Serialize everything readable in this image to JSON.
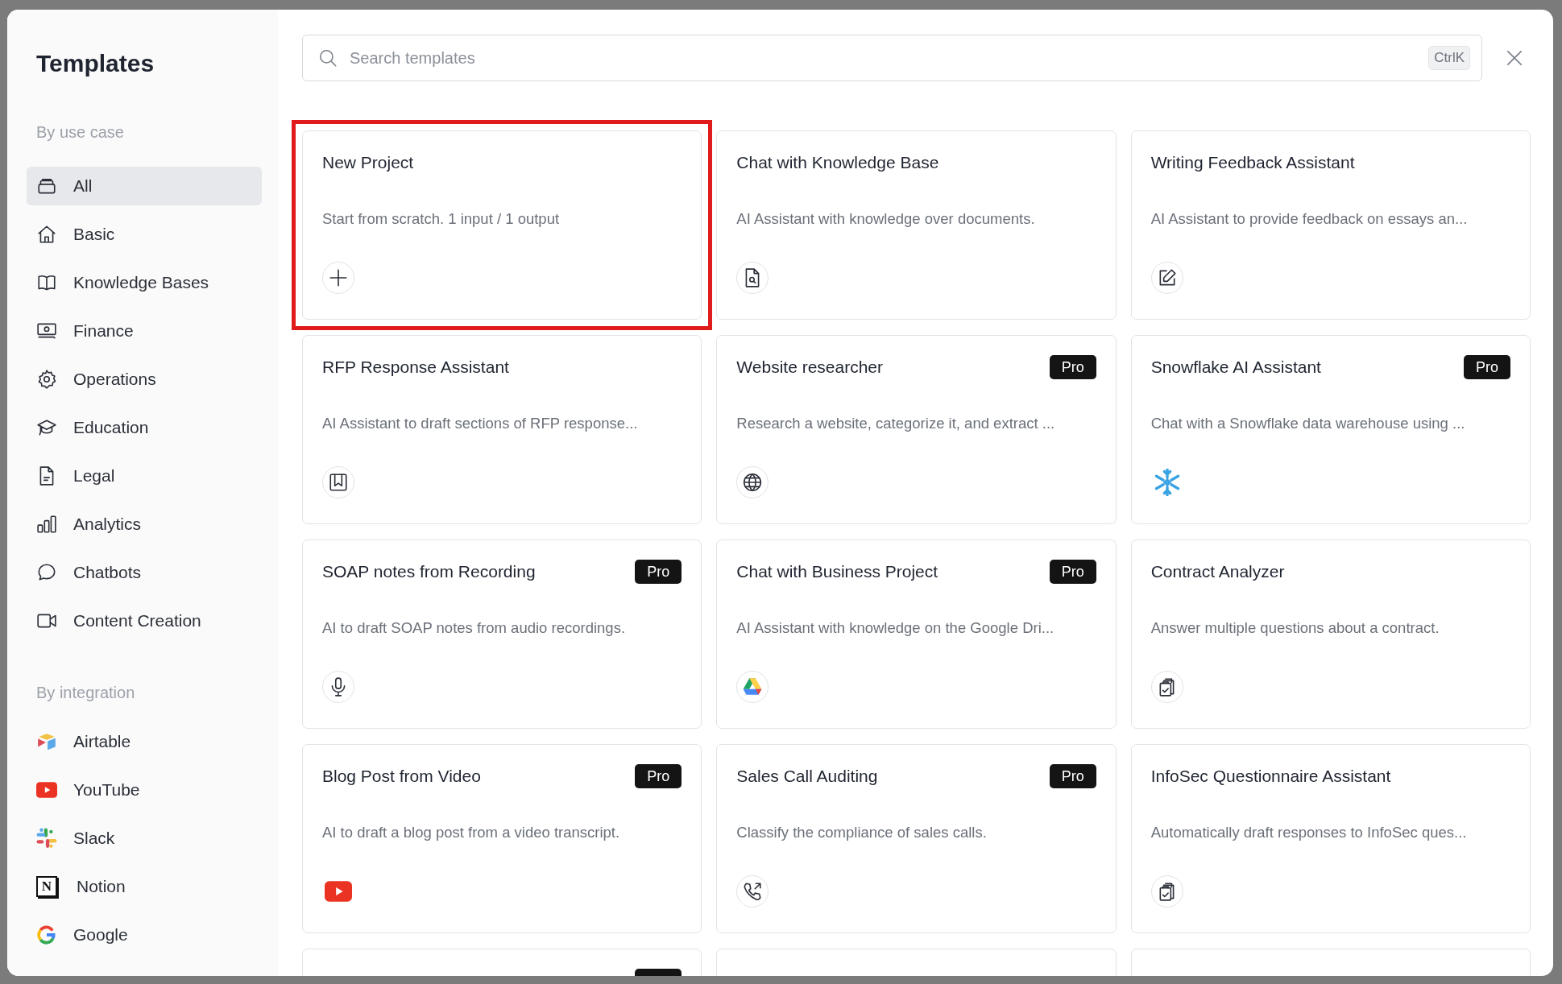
{
  "sidebar": {
    "title": "Templates",
    "sections": [
      {
        "heading": "By use case",
        "items": [
          {
            "label": "All",
            "kind": "tray",
            "selected": true
          },
          {
            "label": "Basic",
            "kind": "home",
            "selected": false
          },
          {
            "label": "Knowledge Bases",
            "kind": "book",
            "selected": false
          },
          {
            "label": "Finance",
            "kind": "money",
            "selected": false
          },
          {
            "label": "Operations",
            "kind": "gear",
            "selected": false
          },
          {
            "label": "Education",
            "kind": "cap",
            "selected": false
          },
          {
            "label": "Legal",
            "kind": "file",
            "selected": false
          },
          {
            "label": "Analytics",
            "kind": "bars",
            "selected": false
          },
          {
            "label": "Chatbots",
            "kind": "chat",
            "selected": false
          },
          {
            "label": "Content Creation",
            "kind": "video",
            "selected": false
          }
        ]
      },
      {
        "heading": "By integration",
        "items": [
          {
            "label": "Airtable",
            "kind": "airtable",
            "selected": false
          },
          {
            "label": "YouTube",
            "kind": "youtube",
            "selected": false
          },
          {
            "label": "Slack",
            "kind": "slack",
            "selected": false
          },
          {
            "label": "Notion",
            "kind": "notion",
            "glyph": "N",
            "selected": false
          },
          {
            "label": "Google",
            "kind": "google",
            "selected": false
          }
        ]
      }
    ]
  },
  "search": {
    "placeholder": "Search templates",
    "shortcut": "CtrlK"
  },
  "cards": [
    {
      "title": "New Project",
      "description": "Start from scratch. 1 input / 1 output",
      "kind": "plus",
      "pro": false,
      "highlighted": true
    },
    {
      "title": "Chat with Knowledge Base",
      "description": "AI Assistant with knowledge over documents.",
      "kind": "docsearch",
      "pro": false,
      "highlighted": false
    },
    {
      "title": "Writing Feedback Assistant",
      "description": "AI Assistant to provide feedback on essays an...",
      "kind": "edit",
      "pro": false,
      "highlighted": false
    },
    {
      "title": "RFP Response Assistant",
      "description": "AI Assistant to draft sections of RFP response...",
      "kind": "bookmark",
      "pro": false,
      "highlighted": false
    },
    {
      "title": "Website researcher",
      "description": "Research a website, categorize it, and extract ...",
      "kind": "globe",
      "pro": true,
      "badge": "Pro",
      "highlighted": false
    },
    {
      "title": "Snowflake AI Assistant",
      "description": "Chat with a Snowflake data warehouse using ...",
      "kind": "snowflake",
      "pro": true,
      "badge": "Pro",
      "highlighted": false
    },
    {
      "title": "SOAP notes from Recording",
      "description": "AI to draft SOAP notes from audio recordings.",
      "kind": "mic",
      "pro": true,
      "badge": "Pro",
      "highlighted": false
    },
    {
      "title": "Chat with Business Project",
      "description": "AI Assistant with knowledge on the Google Dri...",
      "kind": "drive",
      "pro": true,
      "badge": "Pro",
      "highlighted": false
    },
    {
      "title": "Contract Analyzer",
      "description": "Answer multiple questions about a contract.",
      "kind": "clipboard",
      "pro": false,
      "highlighted": false
    },
    {
      "title": "Blog Post from Video",
      "description": "AI to draft a blog post from a video transcript.",
      "kind": "youtube",
      "pro": true,
      "badge": "Pro",
      "highlighted": false
    },
    {
      "title": "Sales Call Auditing",
      "description": "Classify the compliance of sales calls.",
      "kind": "phone",
      "pro": true,
      "badge": "Pro",
      "highlighted": false
    },
    {
      "title": "InfoSec Questionnaire Assistant",
      "description": "Automatically draft responses to InfoSec ques...",
      "kind": "clipboard",
      "pro": false,
      "highlighted": false
    },
    {
      "pro": true
    },
    {
      "pro": false
    },
    {
      "pro": false
    }
  ]
}
